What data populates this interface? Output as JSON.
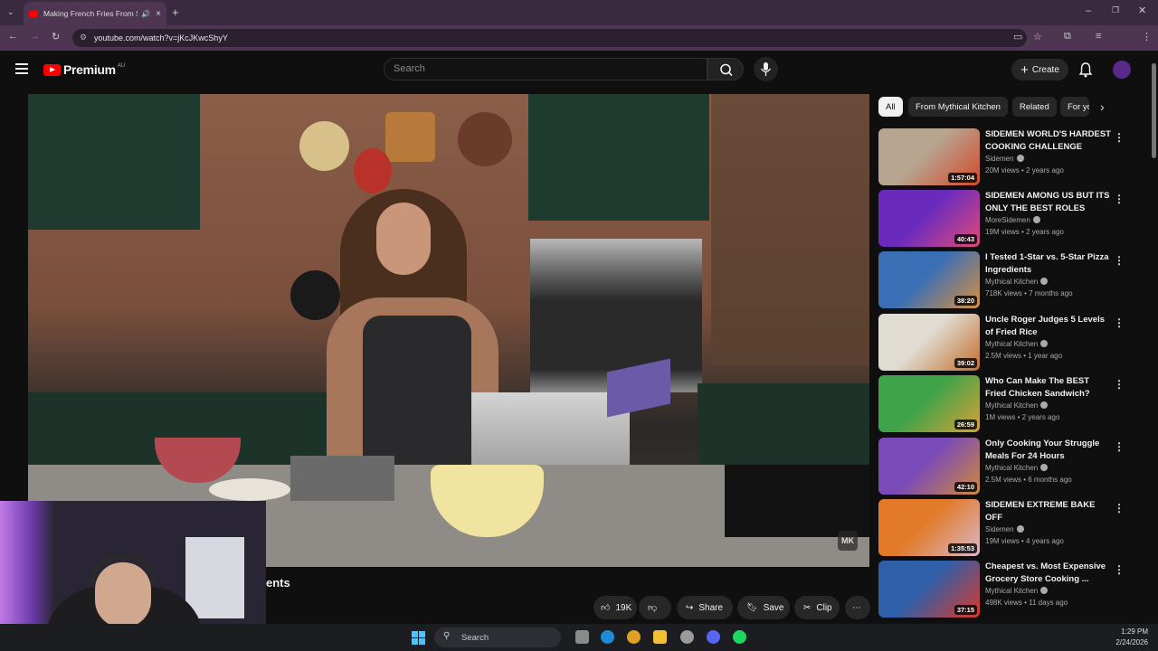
{
  "browser": {
    "tab_title": "Making French Fries From Scratch",
    "url": "youtube.com/watch?v=jKcJKwcShyY"
  },
  "header": {
    "logo_text": "Premium",
    "logo_country": "AU",
    "search_placeholder": "Search",
    "create_label": "Create"
  },
  "player": {
    "comments_fragment": "ents",
    "like_count": "19K",
    "share_label": "Share",
    "save_label": "Save",
    "clip_label": "Clip"
  },
  "chips": [
    "All",
    "From Mythical Kitchen",
    "Related",
    "For yo"
  ],
  "related": [
    {
      "title": "SIDEMEN WORLD'S HARDEST COOKING CHALLENGE",
      "channel": "Sidemen",
      "meta": "20M views • 2 years ago",
      "duration": "1:57:04",
      "thumb_colors": [
        "#b8a590",
        "#d24a2a"
      ]
    },
    {
      "title": "SIDEMEN AMONG US BUT ITS ONLY THE BEST ROLES",
      "channel": "MoreSidemen",
      "meta": "19M views • 2 years ago",
      "duration": "40:43",
      "thumb_colors": [
        "#6a2bbd",
        "#e04a7a"
      ]
    },
    {
      "title": "I Tested 1-Star vs. 5-Star Pizza Ingredients",
      "channel": "Mythical Kitchen",
      "meta": "718K views • 7 months ago",
      "duration": "38:20",
      "thumb_colors": [
        "#3a6fb5",
        "#d89040"
      ]
    },
    {
      "title": "Uncle Roger Judges 5 Levels of Fried Rice",
      "channel": "Mythical Kitchen",
      "meta": "2.5M views • 1 year ago",
      "duration": "39:02",
      "thumb_colors": [
        "#e0dcd2",
        "#c46d2c"
      ]
    },
    {
      "title": "Who Can Make The BEST Fried Chicken Sandwich?",
      "channel": "Mythical Kitchen",
      "meta": "1M views • 2 years ago",
      "duration": "26:59",
      "thumb_colors": [
        "#3fa34a",
        "#d8a236"
      ]
    },
    {
      "title": "Only Cooking Your Struggle Meals For 24 Hours",
      "channel": "Mythical Kitchen",
      "meta": "2.5M views • 6 months ago",
      "duration": "42:10",
      "thumb_colors": [
        "#7a4ab8",
        "#d08a3a"
      ]
    },
    {
      "title": "SIDEMEN EXTREME BAKE OFF",
      "channel": "Sidemen",
      "meta": "19M views • 4 years ago",
      "duration": "1:35:53",
      "thumb_colors": [
        "#e27a2a",
        "#d9b9c8"
      ]
    },
    {
      "title": "Cheapest vs. Most Expensive Grocery Store Cooking ...",
      "channel": "Mythical Kitchen",
      "meta": "498K views • 11 days ago",
      "duration": "37:15",
      "thumb_colors": [
        "#2f5fa8",
        "#d93a2a"
      ]
    }
  ],
  "taskbar": {
    "search_label": "Search",
    "time": "1:29 PM",
    "date": "2/24/2026"
  },
  "colors": {
    "youtube_red": "#ff0000",
    "background": "#0f0f0f",
    "chrome_tab": "#4e3652"
  }
}
